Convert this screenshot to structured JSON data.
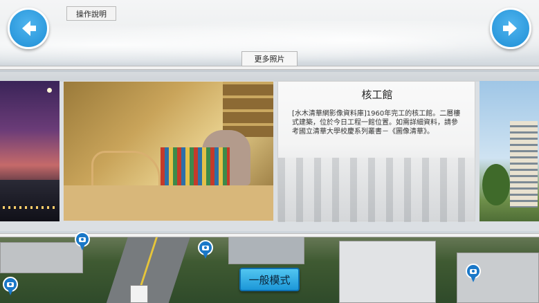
{
  "toolbar": {
    "help_label": "操作說明",
    "back_icon": "arrow-left-icon",
    "next_icon": "arrow-right-icon",
    "accent_color": "#1f8fd6"
  },
  "gallery": {
    "more_photos_label": "更多照片",
    "info": {
      "title": "核工館",
      "description": "[水木清華網影像資料庫]1960年完工的核工館。二層樓式建築，位於今日工程一館位置。如需詳細資料，請參考國立清華大學校慶系列叢書－《圖像清華》。"
    }
  },
  "map": {
    "pin_icon": "camera-icon",
    "mode_label": "一般模式"
  }
}
